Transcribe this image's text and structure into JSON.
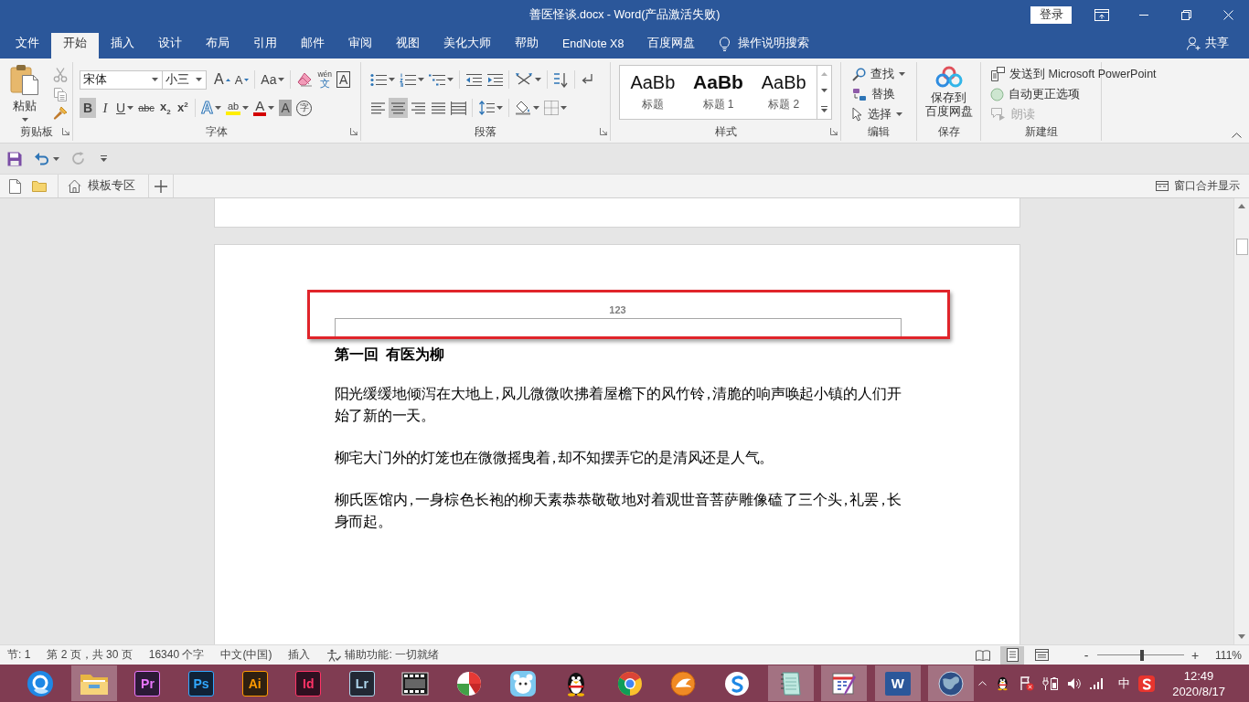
{
  "title_bar": {
    "title": "善医怪谈.docx - Word(产品激活失败)",
    "sign_in": "登录"
  },
  "menu_tabs": [
    {
      "label": "文件",
      "selected": false
    },
    {
      "label": "开始",
      "selected": true
    },
    {
      "label": "插入",
      "selected": false
    },
    {
      "label": "设计",
      "selected": false
    },
    {
      "label": "布局",
      "selected": false
    },
    {
      "label": "引用",
      "selected": false
    },
    {
      "label": "邮件",
      "selected": false
    },
    {
      "label": "审阅",
      "selected": false
    },
    {
      "label": "视图",
      "selected": false
    },
    {
      "label": "美化大师",
      "selected": false
    },
    {
      "label": "帮助",
      "selected": false
    },
    {
      "label": "EndNote X8",
      "selected": false
    },
    {
      "label": "百度网盘",
      "selected": false
    }
  ],
  "tell_me": "操作说明搜索",
  "share": "共享",
  "ribbon": {
    "clipboard": {
      "label": "剪贴板",
      "launcher": true,
      "paste": "粘贴",
      "tools": [
        {
          "kind": "cut",
          "disabled": true
        },
        {
          "kind": "copy",
          "disabled": true
        },
        {
          "kind": "format_painter",
          "disabled": false
        }
      ]
    },
    "font": {
      "label": "字体",
      "launcher": true,
      "font_name": "宋体",
      "font_size": "小三",
      "row_1": [
        {
          "kind": "grow",
          "text": "A"
        },
        {
          "kind": "shrink",
          "text": "A"
        },
        {
          "kind": "case",
          "text": "Aa"
        },
        {
          "kind": "clear"
        },
        {
          "kind": "phonetic",
          "text": "wén",
          "sub": "文"
        },
        {
          "kind": "border",
          "text": "A"
        }
      ],
      "toggles": [
        {
          "kind": "bold",
          "text": "B",
          "pressed": true
        },
        {
          "kind": "italic",
          "text": "I",
          "pressed": false
        },
        {
          "kind": "underline",
          "text": "U",
          "pressed": false
        },
        {
          "kind": "strike",
          "text": "abc",
          "pressed": false
        },
        {
          "kind": "subscript",
          "text": "x$_{2}$",
          "pressed": false
        },
        {
          "kind": "superscript",
          "text": "x$^{2}$",
          "pressed": false
        }
      ],
      "row_2": [
        {
          "kind": "effects",
          "text": "A"
        },
        {
          "kind": "highlight",
          "text": "ab"
        },
        {
          "kind": "color",
          "text": "A"
        },
        {
          "kind": "shading",
          "text": "A"
        },
        {
          "kind": "enclosed",
          "text": "字"
        }
      ]
    },
    "paragraph": {
      "label": "段落",
      "launcher": true,
      "alignment": [
        {
          "kind": "left",
          "pressed": false
        },
        {
          "kind": "center",
          "pressed": true
        },
        {
          "kind": "right",
          "pressed": false
        },
        {
          "kind": "justify",
          "pressed": false
        },
        {
          "kind": "distributed",
          "pressed": false
        }
      ]
    },
    "styles": {
      "label": "样式",
      "launcher": true,
      "items": [
        {
          "kind": "title",
          "preview": "AaBb",
          "name": "标题",
          "selected": false
        },
        {
          "kind": "heading_1",
          "preview": "AaBb",
          "name": "标题 1",
          "selected": false
        },
        {
          "kind": "heading_2",
          "preview": "AaBb",
          "name": "标题 2",
          "selected": false
        }
      ]
    },
    "editing": {
      "label": "编辑",
      "items": [
        {
          "kind": "find",
          "label": "查找"
        },
        {
          "kind": "replace",
          "label": "替换"
        },
        {
          "kind": "select",
          "label": "选择"
        }
      ]
    },
    "save": {
      "label": "保存",
      "button": [
        "保存到",
        "百度网盘"
      ]
    },
    "new_group": {
      "label": "新建组",
      "items": [
        {
          "kind": "send",
          "label": "发送到 Microsoft PowerPoint",
          "disabled": false
        },
        {
          "kind": "autocorrect",
          "label": "自动更正选项",
          "disabled": false
        },
        {
          "kind": "read_aloud",
          "label": "朗读",
          "disabled": true
        }
      ]
    }
  },
  "quick_access": [
    {
      "kind": "save",
      "disabled": false
    },
    {
      "kind": "undo",
      "disabled": false
    },
    {
      "kind": "redo",
      "disabled": true
    },
    {
      "kind": "customize",
      "disabled": false
    }
  ],
  "doc_tabs": {
    "template_tab": "模板专区",
    "merge_windows": "窗口合并显示"
  },
  "document": {
    "header": "123",
    "heading": "第一回  有医为柳",
    "paragraphs": [
      "阳光缓缓地倾泻在大地上，风儿微微吹拂着屋檐下的风竹铃，清脆的响声唤起小镇的人们开始了新的一天。",
      "柳宅大门外的灯笼也在微微摇曳着，却不知摆弄它的是清风还是人气。",
      "柳氏医馆内，一身棕色长袍的柳天素恭恭敬敬地对着观世音菩萨雕像磕了三个头，礼罢，长身而起。"
    ]
  },
  "status_bar": {
    "items": [
      "节: 1",
      "第 2 页，共 30 页",
      "16340 个字",
      "中文(中国)",
      "插入"
    ],
    "accessibility": "辅助功能: 一切就绪",
    "views": [
      {
        "kind": "read",
        "selected": false
      },
      {
        "kind": "print",
        "selected": true
      },
      {
        "kind": "web",
        "selected": false
      }
    ],
    "zoom_out": "-",
    "zoom": {
      "level": 0.52
    },
    "zoom_in": "+",
    "zoom_label": "111%"
  },
  "taskbar": {
    "apps": [
      {
        "kind": "ring",
        "open": false
      },
      {
        "kind": "folder",
        "open": true
      },
      {
        "kind": "tile",
        "text": "Pr",
        "color": "#ea77ff",
        "open": false
      },
      {
        "kind": "tile",
        "text": "Ps",
        "color": "#31a8ff",
        "open": false
      },
      {
        "kind": "tile",
        "text": "Ai",
        "color": "#ff9a00",
        "open": false
      },
      {
        "kind": "tile",
        "text": "Id",
        "color": "#ff3366",
        "open": false
      },
      {
        "kind": "tile",
        "text": "Lr",
        "color": "#add5ec",
        "open": false
      },
      {
        "kind": "film",
        "open": false
      },
      {
        "kind": "pie",
        "open": false
      },
      {
        "kind": "cartoon",
        "open": false
      },
      {
        "kind": "penguin",
        "open": false
      },
      {
        "kind": "wheel",
        "open": false
      },
      {
        "kind": "bird",
        "open": false
      },
      {
        "kind": "swirl",
        "open": false
      },
      {
        "kind": "notebook",
        "open": true
      },
      {
        "kind": "calendar",
        "open": true
      },
      {
        "kind": "word",
        "text": "W",
        "open": true
      },
      {
        "kind": "globe",
        "open": true
      }
    ],
    "tray": {
      "ime": "中",
      "time": "12:49",
      "date": "2020/8/17"
    }
  }
}
